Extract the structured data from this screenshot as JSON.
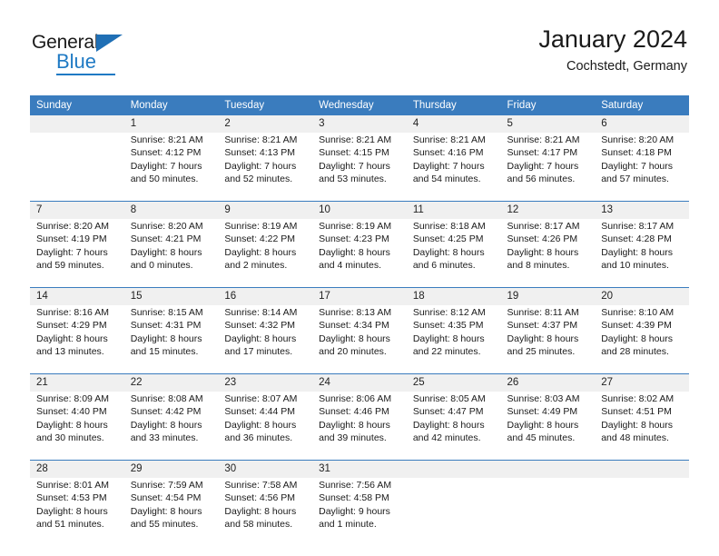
{
  "logo": {
    "word1": "General",
    "word2": "Blue",
    "triangle_color": "#1f6fb5",
    "blue_color": "#1f7ac4"
  },
  "header": {
    "title": "January 2024",
    "subtitle": "Cochstedt, Germany"
  },
  "theme": {
    "header_bg": "#3a7cbe",
    "daynum_bg": "#f0f0f0"
  },
  "calendar": {
    "weekdays": [
      "Sunday",
      "Monday",
      "Tuesday",
      "Wednesday",
      "Thursday",
      "Friday",
      "Saturday"
    ],
    "weeks": [
      [
        {
          "day": "",
          "sunrise": "",
          "sunset": "",
          "daylight1": "",
          "daylight2": ""
        },
        {
          "day": "1",
          "sunrise": "Sunrise: 8:21 AM",
          "sunset": "Sunset: 4:12 PM",
          "daylight1": "Daylight: 7 hours",
          "daylight2": "and 50 minutes."
        },
        {
          "day": "2",
          "sunrise": "Sunrise: 8:21 AM",
          "sunset": "Sunset: 4:13 PM",
          "daylight1": "Daylight: 7 hours",
          "daylight2": "and 52 minutes."
        },
        {
          "day": "3",
          "sunrise": "Sunrise: 8:21 AM",
          "sunset": "Sunset: 4:15 PM",
          "daylight1": "Daylight: 7 hours",
          "daylight2": "and 53 minutes."
        },
        {
          "day": "4",
          "sunrise": "Sunrise: 8:21 AM",
          "sunset": "Sunset: 4:16 PM",
          "daylight1": "Daylight: 7 hours",
          "daylight2": "and 54 minutes."
        },
        {
          "day": "5",
          "sunrise": "Sunrise: 8:21 AM",
          "sunset": "Sunset: 4:17 PM",
          "daylight1": "Daylight: 7 hours",
          "daylight2": "and 56 minutes."
        },
        {
          "day": "6",
          "sunrise": "Sunrise: 8:20 AM",
          "sunset": "Sunset: 4:18 PM",
          "daylight1": "Daylight: 7 hours",
          "daylight2": "and 57 minutes."
        }
      ],
      [
        {
          "day": "7",
          "sunrise": "Sunrise: 8:20 AM",
          "sunset": "Sunset: 4:19 PM",
          "daylight1": "Daylight: 7 hours",
          "daylight2": "and 59 minutes."
        },
        {
          "day": "8",
          "sunrise": "Sunrise: 8:20 AM",
          "sunset": "Sunset: 4:21 PM",
          "daylight1": "Daylight: 8 hours",
          "daylight2": "and 0 minutes."
        },
        {
          "day": "9",
          "sunrise": "Sunrise: 8:19 AM",
          "sunset": "Sunset: 4:22 PM",
          "daylight1": "Daylight: 8 hours",
          "daylight2": "and 2 minutes."
        },
        {
          "day": "10",
          "sunrise": "Sunrise: 8:19 AM",
          "sunset": "Sunset: 4:23 PM",
          "daylight1": "Daylight: 8 hours",
          "daylight2": "and 4 minutes."
        },
        {
          "day": "11",
          "sunrise": "Sunrise: 8:18 AM",
          "sunset": "Sunset: 4:25 PM",
          "daylight1": "Daylight: 8 hours",
          "daylight2": "and 6 minutes."
        },
        {
          "day": "12",
          "sunrise": "Sunrise: 8:17 AM",
          "sunset": "Sunset: 4:26 PM",
          "daylight1": "Daylight: 8 hours",
          "daylight2": "and 8 minutes."
        },
        {
          "day": "13",
          "sunrise": "Sunrise: 8:17 AM",
          "sunset": "Sunset: 4:28 PM",
          "daylight1": "Daylight: 8 hours",
          "daylight2": "and 10 minutes."
        }
      ],
      [
        {
          "day": "14",
          "sunrise": "Sunrise: 8:16 AM",
          "sunset": "Sunset: 4:29 PM",
          "daylight1": "Daylight: 8 hours",
          "daylight2": "and 13 minutes."
        },
        {
          "day": "15",
          "sunrise": "Sunrise: 8:15 AM",
          "sunset": "Sunset: 4:31 PM",
          "daylight1": "Daylight: 8 hours",
          "daylight2": "and 15 minutes."
        },
        {
          "day": "16",
          "sunrise": "Sunrise: 8:14 AM",
          "sunset": "Sunset: 4:32 PM",
          "daylight1": "Daylight: 8 hours",
          "daylight2": "and 17 minutes."
        },
        {
          "day": "17",
          "sunrise": "Sunrise: 8:13 AM",
          "sunset": "Sunset: 4:34 PM",
          "daylight1": "Daylight: 8 hours",
          "daylight2": "and 20 minutes."
        },
        {
          "day": "18",
          "sunrise": "Sunrise: 8:12 AM",
          "sunset": "Sunset: 4:35 PM",
          "daylight1": "Daylight: 8 hours",
          "daylight2": "and 22 minutes."
        },
        {
          "day": "19",
          "sunrise": "Sunrise: 8:11 AM",
          "sunset": "Sunset: 4:37 PM",
          "daylight1": "Daylight: 8 hours",
          "daylight2": "and 25 minutes."
        },
        {
          "day": "20",
          "sunrise": "Sunrise: 8:10 AM",
          "sunset": "Sunset: 4:39 PM",
          "daylight1": "Daylight: 8 hours",
          "daylight2": "and 28 minutes."
        }
      ],
      [
        {
          "day": "21",
          "sunrise": "Sunrise: 8:09 AM",
          "sunset": "Sunset: 4:40 PM",
          "daylight1": "Daylight: 8 hours",
          "daylight2": "and 30 minutes."
        },
        {
          "day": "22",
          "sunrise": "Sunrise: 8:08 AM",
          "sunset": "Sunset: 4:42 PM",
          "daylight1": "Daylight: 8 hours",
          "daylight2": "and 33 minutes."
        },
        {
          "day": "23",
          "sunrise": "Sunrise: 8:07 AM",
          "sunset": "Sunset: 4:44 PM",
          "daylight1": "Daylight: 8 hours",
          "daylight2": "and 36 minutes."
        },
        {
          "day": "24",
          "sunrise": "Sunrise: 8:06 AM",
          "sunset": "Sunset: 4:46 PM",
          "daylight1": "Daylight: 8 hours",
          "daylight2": "and 39 minutes."
        },
        {
          "day": "25",
          "sunrise": "Sunrise: 8:05 AM",
          "sunset": "Sunset: 4:47 PM",
          "daylight1": "Daylight: 8 hours",
          "daylight2": "and 42 minutes."
        },
        {
          "day": "26",
          "sunrise": "Sunrise: 8:03 AM",
          "sunset": "Sunset: 4:49 PM",
          "daylight1": "Daylight: 8 hours",
          "daylight2": "and 45 minutes."
        },
        {
          "day": "27",
          "sunrise": "Sunrise: 8:02 AM",
          "sunset": "Sunset: 4:51 PM",
          "daylight1": "Daylight: 8 hours",
          "daylight2": "and 48 minutes."
        }
      ],
      [
        {
          "day": "28",
          "sunrise": "Sunrise: 8:01 AM",
          "sunset": "Sunset: 4:53 PM",
          "daylight1": "Daylight: 8 hours",
          "daylight2": "and 51 minutes."
        },
        {
          "day": "29",
          "sunrise": "Sunrise: 7:59 AM",
          "sunset": "Sunset: 4:54 PM",
          "daylight1": "Daylight: 8 hours",
          "daylight2": "and 55 minutes."
        },
        {
          "day": "30",
          "sunrise": "Sunrise: 7:58 AM",
          "sunset": "Sunset: 4:56 PM",
          "daylight1": "Daylight: 8 hours",
          "daylight2": "and 58 minutes."
        },
        {
          "day": "31",
          "sunrise": "Sunrise: 7:56 AM",
          "sunset": "Sunset: 4:58 PM",
          "daylight1": "Daylight: 9 hours",
          "daylight2": "and 1 minute."
        },
        {
          "day": "",
          "sunrise": "",
          "sunset": "",
          "daylight1": "",
          "daylight2": ""
        },
        {
          "day": "",
          "sunrise": "",
          "sunset": "",
          "daylight1": "",
          "daylight2": ""
        },
        {
          "day": "",
          "sunrise": "",
          "sunset": "",
          "daylight1": "",
          "daylight2": ""
        }
      ]
    ]
  }
}
